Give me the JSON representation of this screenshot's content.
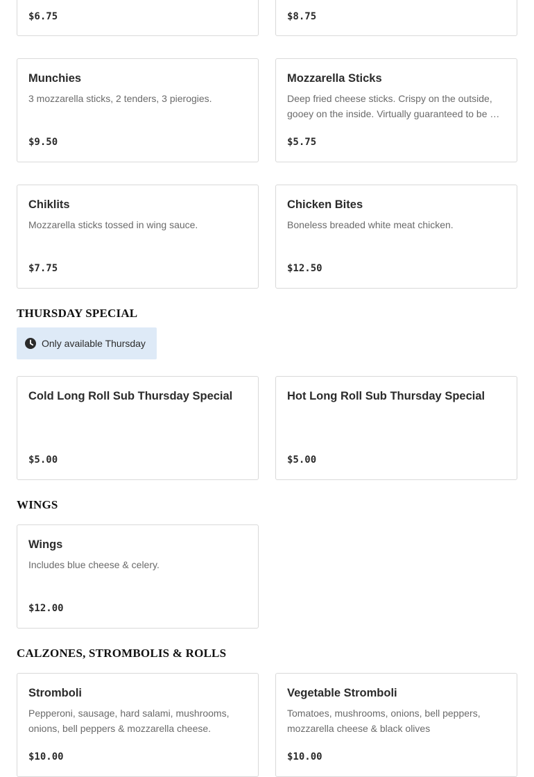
{
  "top_cards": [
    {
      "price": "$6.75"
    },
    {
      "price": "$8.75"
    }
  ],
  "appetizers": [
    {
      "name": "Munchies",
      "description": "3 mozzarella sticks, 2 tenders, 3 pierogies.",
      "price": "$9.50"
    },
    {
      "name": "Mozzarella Sticks",
      "description": "Deep fried cheese sticks. Crispy on the outside, gooey on the inside. Virtually guaranteed to be …",
      "price": "$5.75"
    },
    {
      "name": "Chiklits",
      "description": "Mozzarella sticks tossed in wing sauce.",
      "price": "$7.75"
    },
    {
      "name": "Chicken Bites",
      "description": "Boneless breaded white meat chicken.",
      "price": "$12.50"
    }
  ],
  "thursday": {
    "title": "THURSDAY SPECIAL",
    "badge": "Only available Thursday",
    "badge_icon": "clock-icon",
    "items": [
      {
        "name": "Cold Long Roll Sub Thursday Special",
        "price": "$5.00"
      },
      {
        "name": "Hot Long Roll Sub Thursday Special",
        "price": "$5.00"
      }
    ]
  },
  "wings": {
    "title": "WINGS",
    "items": [
      {
        "name": "Wings",
        "description": "Includes blue cheese & celery.",
        "price": "$12.00"
      }
    ]
  },
  "calzones": {
    "title": "CALZONES, STROMBOLIS & ROLLS",
    "items": [
      {
        "name": "Stromboli",
        "description": "Pepperoni, sausage, hard salami, mushrooms, onions, bell peppers & mozzarella cheese.",
        "price": "$10.00"
      },
      {
        "name": "Vegetable Stromboli",
        "description": "Tomatoes, mushrooms, onions, bell peppers, mozzarella cheese & black olives",
        "price": "$10.00"
      }
    ]
  },
  "colors": {
    "badge_bg": "#deeaf7",
    "border": "#d9d9d9",
    "description": "#6a6a6a"
  }
}
